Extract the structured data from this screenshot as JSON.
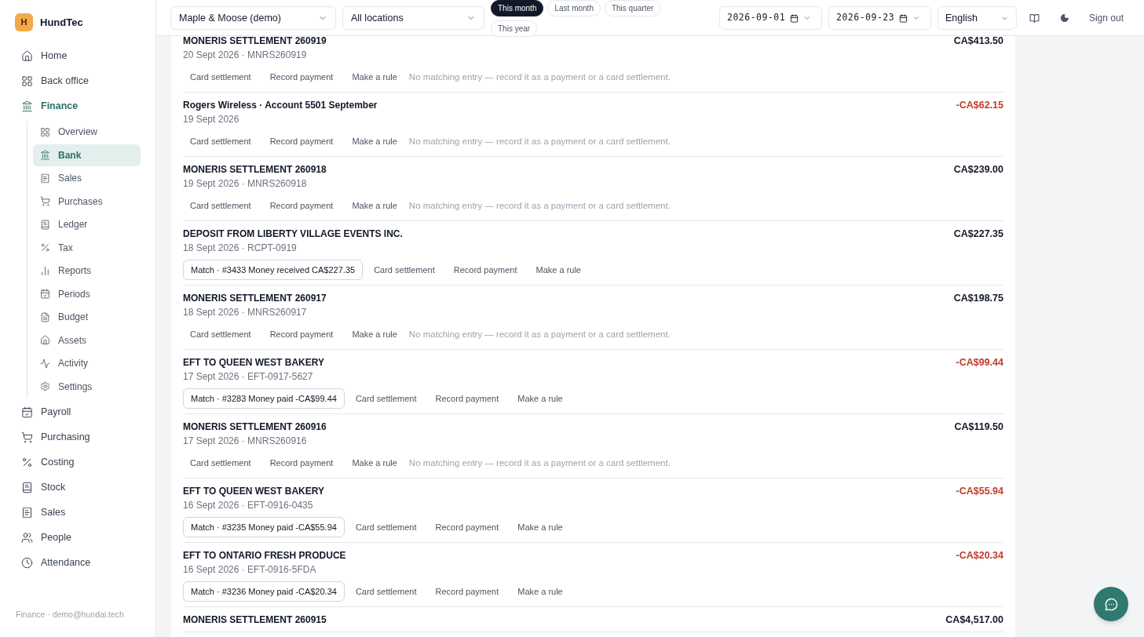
{
  "brand": {
    "initial": "H",
    "name": "HundTec"
  },
  "sidebar": {
    "items": [
      {
        "label": "Home",
        "selected": false
      },
      {
        "label": "Back office",
        "selected": false
      },
      {
        "label": "Finance",
        "selected": true,
        "expanded": true,
        "children": [
          {
            "label": "Overview",
            "selected": false
          },
          {
            "label": "Bank",
            "selected": true
          },
          {
            "label": "Sales",
            "selected": false
          },
          {
            "label": "Purchases",
            "selected": false
          },
          {
            "label": "Ledger",
            "selected": false
          },
          {
            "label": "Tax",
            "selected": false
          },
          {
            "label": "Reports",
            "selected": false
          },
          {
            "label": "Periods",
            "selected": false
          },
          {
            "label": "Budget",
            "selected": false
          },
          {
            "label": "Assets",
            "selected": false
          },
          {
            "label": "Activity",
            "selected": false
          },
          {
            "label": "Settings",
            "selected": false
          }
        ]
      },
      {
        "label": "Payroll",
        "selected": false
      },
      {
        "label": "Purchasing",
        "selected": false
      },
      {
        "label": "Costing",
        "selected": false
      },
      {
        "label": "Stock",
        "selected": false
      },
      {
        "label": "Sales",
        "selected": false
      },
      {
        "label": "People",
        "selected": false
      },
      {
        "label": "Attendance",
        "selected": false
      }
    ],
    "footer": "Finance · demo@hundai.tech"
  },
  "header": {
    "company": "Maple & Moose (demo)",
    "location": "All locations",
    "periods": [
      {
        "label": "This month",
        "selected": true
      },
      {
        "label": "Last month",
        "selected": false
      },
      {
        "label": "This quarter",
        "selected": false
      },
      {
        "label": "This year",
        "selected": false
      }
    ],
    "date_from": "2026-09-01",
    "date_to": "2026-09-23",
    "language": "English",
    "sign_out": "Sign out"
  },
  "transactions": [
    {
      "title": "MONERIS SETTLEMENT 260919",
      "amount": "CA$413.50",
      "negative": false,
      "meta": "20 Sept 2026 · MNRS260919",
      "actions": [
        "Card settlement",
        "Record payment",
        "Make a rule"
      ],
      "note": "No matching entry — record it as a payment or a card settlement."
    },
    {
      "title": "Rogers Wireless · Account 5501 September",
      "amount": "-CA$62.15",
      "negative": true,
      "meta": "19 Sept 2026",
      "actions": [
        "Card settlement",
        "Record payment",
        "Make a rule"
      ],
      "note": "No matching entry — record it as a payment or a card settlement."
    },
    {
      "title": "MONERIS SETTLEMENT 260918",
      "amount": "CA$239.00",
      "negative": false,
      "meta": "19 Sept 2026 · MNRS260918",
      "actions": [
        "Card settlement",
        "Record payment",
        "Make a rule"
      ],
      "note": "No matching entry — record it as a payment or a card settlement."
    },
    {
      "title": "DEPOSIT FROM LIBERTY VILLAGE EVENTS INC.",
      "amount": "CA$227.35",
      "negative": false,
      "meta": "18 Sept 2026 · RCPT-0919",
      "match": "Match · #3433 Money received CA$227.35",
      "actions": [
        "Card settlement",
        "Record payment",
        "Make a rule"
      ]
    },
    {
      "title": "MONERIS SETTLEMENT 260917",
      "amount": "CA$198.75",
      "negative": false,
      "meta": "18 Sept 2026 · MNRS260917",
      "actions": [
        "Card settlement",
        "Record payment",
        "Make a rule"
      ],
      "note": "No matching entry — record it as a payment or a card settlement."
    },
    {
      "title": "EFT TO QUEEN WEST BAKERY",
      "amount": "-CA$99.44",
      "negative": true,
      "meta": "17 Sept 2026 · EFT-0917-5627",
      "match": "Match · #3283 Money paid -CA$99.44",
      "actions": [
        "Card settlement",
        "Record payment",
        "Make a rule"
      ]
    },
    {
      "title": "MONERIS SETTLEMENT 260916",
      "amount": "CA$119.50",
      "negative": false,
      "meta": "17 Sept 2026 · MNRS260916",
      "actions": [
        "Card settlement",
        "Record payment",
        "Make a rule"
      ],
      "note": "No matching entry — record it as a payment or a card settlement."
    },
    {
      "title": "EFT TO QUEEN WEST BAKERY",
      "amount": "-CA$55.94",
      "negative": true,
      "meta": "16 Sept 2026 · EFT-0916-0435",
      "match": "Match · #3235 Money paid -CA$55.94",
      "actions": [
        "Card settlement",
        "Record payment",
        "Make a rule"
      ]
    },
    {
      "title": "EFT TO ONTARIO FRESH PRODUCE",
      "amount": "-CA$20.34",
      "negative": true,
      "meta": "16 Sept 2026 · EFT-0916-5FDA",
      "match": "Match · #3236 Money paid -CA$20.34",
      "actions": [
        "Card settlement",
        "Record payment",
        "Make a rule"
      ]
    },
    {
      "title": "MONERIS SETTLEMENT 260915",
      "amount": "CA$4,517.00",
      "negative": false
    }
  ]
}
